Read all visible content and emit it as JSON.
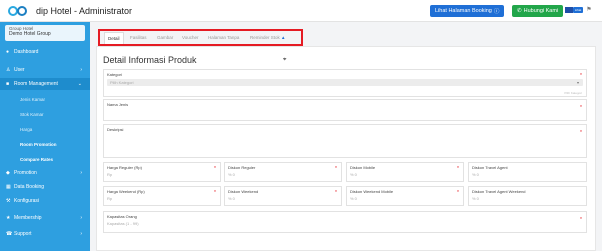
{
  "app": {
    "title": "dip Hotel - Administrator",
    "brand_color": "#2e9fe0"
  },
  "topbar": {
    "booking_button": "Lihat Halaman Booking",
    "booking_icon": "info-icon",
    "contact_button": "Hubungi Kami",
    "contact_icon": "phone-icon",
    "language_badge": "Lihat",
    "user_label": "Demohote..."
  },
  "sidebar": {
    "group_label": "Group Hotel",
    "group_value": "Demo Hotel Group",
    "items": [
      {
        "label": "Dashboard",
        "icon": "dashboard-icon"
      },
      {
        "label": "User",
        "icon": "user-icon"
      },
      {
        "label": "Room Management",
        "icon": "room-icon"
      },
      {
        "label": "Promotion",
        "icon": "tag-icon"
      },
      {
        "label": "Data Booking",
        "icon": "book-icon"
      },
      {
        "label": "Konfigurasi",
        "icon": "wrench-icon"
      },
      {
        "label": "Membership",
        "icon": "member-icon"
      },
      {
        "label": "Support",
        "icon": "support-icon"
      }
    ],
    "sub_items": [
      "Jenis Kamar",
      "Stok Kamar",
      "Harga",
      "Room Promotion",
      "Compare Rates"
    ]
  },
  "tabs": [
    "Detail",
    "Fasilitas",
    "Gambar",
    "Voucher",
    "Halaman Tanpa",
    "Reminder Stok"
  ],
  "main": {
    "page_title": "Detail Informasi Produk",
    "kategori_label": "Kategori",
    "kategori_placeholder": "Pilih Kategori",
    "kategori_hint": "Pilih Kategori",
    "nama_label": "Nama Jenis",
    "deskripsi_label": "Deskripsi",
    "harga_reguler_label": "Harga Reguler (Rp)",
    "harga_reguler_value": "Rp",
    "diskon_reguler_label": "Diskon Reguler",
    "diskon_reguler_value": "% 0",
    "diskon_mobile_label": "Diskon Mobile",
    "diskon_mobile_value": "% 0",
    "diskon_travel_label": "Diskon Travel Agent",
    "diskon_travel_value": "% 0",
    "harga_weekend_label": "Harga Weekend (Rp)",
    "harga_weekend_value": "Rp",
    "diskon_weekend_label": "Diskon Weekend",
    "diskon_weekend_value": "% 0",
    "diskon_weekend_mobile_label": "Diskon Weekend Mobile",
    "diskon_weekend_mobile_value": "% 0",
    "diskon_travel_weekend_label": "Diskon Travel Agent Weekend",
    "diskon_travel_weekend_value": "% 0",
    "kapasitas_label": "Kapasitas Orang",
    "kapasitas_value": "Kapasitas (1 - 99)"
  }
}
